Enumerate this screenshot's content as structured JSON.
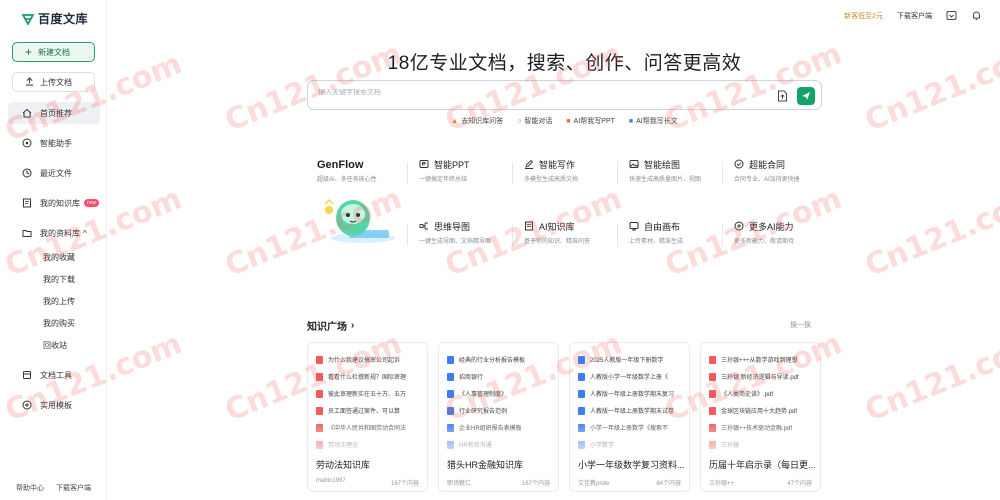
{
  "sidebar": {
    "logo": "百度文库",
    "new_doc": "新建文档",
    "upload_doc": "上传文档",
    "nav": [
      {
        "label": "首页推荐",
        "icon": "home-icon",
        "active": true
      },
      {
        "label": "智能助手",
        "icon": "assistant-icon"
      },
      {
        "label": "最近文件",
        "icon": "clock-icon"
      },
      {
        "label": "我的知识库",
        "icon": "knowledge-icon",
        "badge": "new"
      },
      {
        "label": "我的资料库",
        "icon": "folder-icon",
        "expand": "^"
      }
    ],
    "sub_items": [
      "我的收藏",
      "我的下载",
      "我的上传",
      "我的购买",
      "回收站"
    ],
    "nav2": [
      {
        "label": "文档工具",
        "icon": "tools-icon"
      },
      {
        "label": "实用模板",
        "icon": "template-icon"
      }
    ],
    "footer": [
      "帮助中心",
      "下载客户端"
    ]
  },
  "topbar": {
    "promo": "新客低至2元",
    "download": "下载客户端",
    "icons": [
      "inbox-icon",
      "bell-icon"
    ]
  },
  "hero": {
    "title": "18亿专业文档，搜索、创作、问答更高效",
    "search_placeholder": "输入关键字搜索文档",
    "quick": [
      {
        "label": "去知识库问答",
        "icon": "fire-icon"
      },
      {
        "label": "智能对话",
        "icon": "chat-icon"
      },
      {
        "label": "AI帮我写PPT",
        "icon": "ppt-icon"
      },
      {
        "label": "AI帮我写长文",
        "icon": "write-icon"
      }
    ]
  },
  "features": {
    "genflow": {
      "title": "GenFlow",
      "sub": "超级AI、多任务核心性"
    },
    "items": [
      {
        "title": "智能PPT",
        "sub": "一键搞定年终总结",
        "icon": "ppt-icon"
      },
      {
        "title": "智能写作",
        "sub": "多模型生成高质文档",
        "icon": "pen-icon"
      },
      {
        "title": "智能绘图",
        "sub": "快速生成高质量图片、视图",
        "icon": "image-icon"
      },
      {
        "title": "超能合同",
        "sub": "合同专业、AI加持更快捷",
        "icon": "contract-icon"
      },
      {
        "title": "思维导图",
        "sub": "一键生成导图、文档精导图",
        "icon": "mindmap-icon"
      },
      {
        "title": "AI知识库",
        "sub": "基于你的知识、精准问答",
        "icon": "kb-icon"
      },
      {
        "title": "自由画布",
        "sub": "上传素材、精准生成",
        "icon": "canvas-icon"
      },
      {
        "title": "更多AI能力",
        "sub": "更多新能力、敬请期待",
        "icon": "more-icon"
      }
    ]
  },
  "knowledge": {
    "title": "知识广场",
    "refresh": "换一换",
    "cards": [
      {
        "docs": [
          {
            "t": "为什么我建议搞审公司起诉",
            "k": "pdf"
          },
          {
            "t": "看看什么杜撰新规？国际审理",
            "k": "pdf"
          },
          {
            "t": "彼此审理新实在五十万、五万",
            "k": "pdf"
          },
          {
            "t": "员工面签通过案件、可以算",
            "k": "pdf"
          },
          {
            "t": "《中华人民共和国劳动合同法",
            "k": "pdf"
          },
          {
            "t": "劳动法理论",
            "k": "pdf"
          }
        ],
        "name": "劳动法知识库",
        "author": "mabin1997",
        "count": "167个内容"
      },
      {
        "docs": [
          {
            "t": "经典的行业分析报告模板",
            "k": "word"
          },
          {
            "t": "招商银行",
            "k": "word"
          },
          {
            "t": "《人事管理制度》",
            "k": "word"
          },
          {
            "t": "行业研究报告范例",
            "k": "word"
          },
          {
            "t": "企业HR组织报告表模板",
            "k": "word"
          },
          {
            "t": "HR有效沟通",
            "k": "word"
          }
        ],
        "name": "猎头HR金融知识库",
        "author": "职场魅仁",
        "count": "167个内容"
      },
      {
        "docs": [
          {
            "t": "2025人教版一年级下册数学",
            "k": "word"
          },
          {
            "t": "人教版小学一年级数学上册《",
            "k": "word"
          },
          {
            "t": "人教版一年级上册数学期末复习",
            "k": "word"
          },
          {
            "t": "人教版一年级上册数学期末试卷",
            "k": "word"
          },
          {
            "t": "小学一年级上册数学《搜索不",
            "k": "word"
          },
          {
            "t": "小学数学",
            "k": "word"
          }
        ],
        "name": "小学一年级数学复习资料...",
        "author": "艾佳教pride",
        "count": "84个内容"
      },
      {
        "docs": [
          {
            "t": "三孙银+++从数学游戏到理想",
            "k": "pdf"
          },
          {
            "t": "三孙银 新经济逻辑与导读.pdf",
            "k": "pdf"
          },
          {
            "t": "《人类简史读》.pdf",
            "k": "pdf"
          },
          {
            "t": "金球区块链应用十大趋势.pdf",
            "k": "pdf"
          },
          {
            "t": "三孙银++技术驱动金融.pdf",
            "k": "pdf"
          },
          {
            "t": "三孙银",
            "k": "pdf"
          }
        ],
        "name": "历届十年启示录（每日更...",
        "author": "三孙银++",
        "count": "47个内容"
      }
    ]
  },
  "watermark": "Cn121.com",
  "colors": {
    "brand": "#12a26a",
    "promo": "#c98a2a",
    "pdf": "#f25b5b",
    "word": "#3e7ef1"
  }
}
